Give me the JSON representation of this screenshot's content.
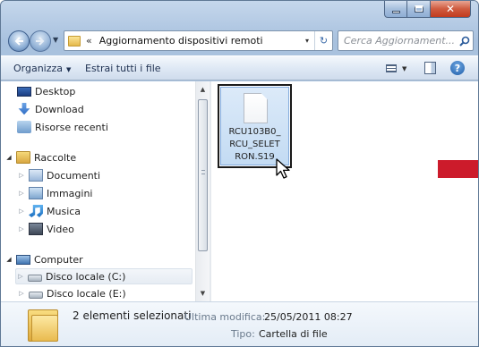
{
  "window": {
    "caption_min": "–",
    "caption_max": "□",
    "caption_close": "✕"
  },
  "address": {
    "chevron": "«",
    "path": "Aggiornamento dispositivi remoti",
    "dropdown_glyph": "▾",
    "refresh_glyph": "↻"
  },
  "search": {
    "placeholder": "Cerca Aggiornament...",
    "icon": "search-icon"
  },
  "commandbar": {
    "organize": "Organizza",
    "extract": "Estrai tutti i file",
    "dropdown_glyph": "▼",
    "help": "?"
  },
  "navpane": {
    "favorites": [
      {
        "label": "Desktop",
        "icon": "desktop-icon"
      },
      {
        "label": "Download",
        "icon": "download-icon"
      },
      {
        "label": "Risorse recenti",
        "icon": "recent-places-icon"
      }
    ],
    "libraries": {
      "label": "Raccolte",
      "items": [
        {
          "label": "Documenti",
          "icon": "documents-icon"
        },
        {
          "label": "Immagini",
          "icon": "pictures-icon"
        },
        {
          "label": "Musica",
          "icon": "music-icon"
        },
        {
          "label": "Video",
          "icon": "video-icon"
        }
      ]
    },
    "computer": {
      "label": "Computer",
      "items": [
        {
          "label": "Disco locale (C:)",
          "icon": "drive-icon"
        },
        {
          "label": "Disco locale (E:)",
          "icon": "drive-icon"
        }
      ]
    },
    "expander_closed": "▷",
    "expander_open": "◢"
  },
  "content": {
    "file": {
      "name": "RCU103B0_RCU_SELETRON.S19",
      "name_lines": [
        "RCU103B0_",
        "RCU_SELET",
        "RON.S19"
      ]
    }
  },
  "details": {
    "count": "2 elementi selezionati",
    "modified_label": "Ultima modifica:",
    "modified_value": "25/05/2011 08:27",
    "type_label": "Tipo:",
    "type_value": "Cartella di file"
  },
  "colors": {
    "accent_red": "#cc1b2b",
    "selection": "#c3dbf3"
  }
}
